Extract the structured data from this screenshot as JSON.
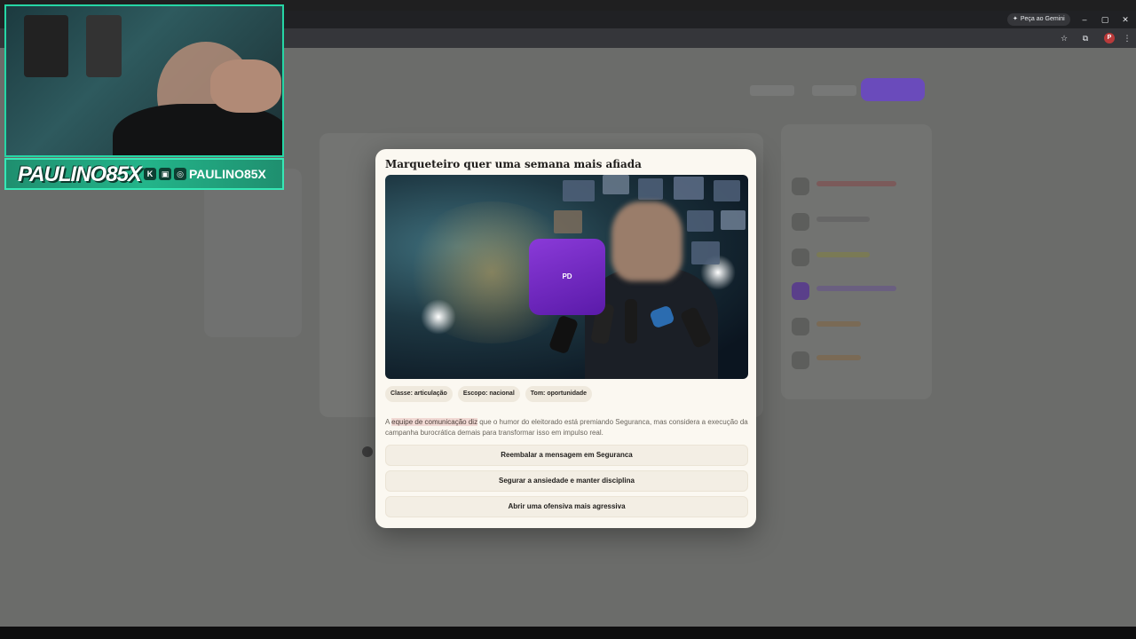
{
  "browser": {
    "gemini_label": "Peça ao Gemini",
    "profile_initial": "P",
    "window_controls": [
      "–",
      "▢",
      "✕"
    ]
  },
  "stream": {
    "logo": "PAULINO85X",
    "handle": "PAULINO85X",
    "accent_color": "#26d6a5"
  },
  "modal": {
    "title": "Marqueteiro quer uma semana mais afiada",
    "badge": "PD",
    "tags": [
      "Classe: articulação",
      "Escopo: nacional",
      "Tom: oportunidade"
    ],
    "body_highlight": "equipe de comunicação diz",
    "body_prefix": "A ",
    "body_rest": " que o humor do eleitorado está premiando Seguranca, mas considera a execução da campanha burocrática demais para transformar isso em impulso real.",
    "options": [
      "Reembalar a mensagem em Seguranca",
      "Segurar a ansiedade e manter disciplina",
      "Abrir uma ofensiva mais agressiva"
    ]
  }
}
